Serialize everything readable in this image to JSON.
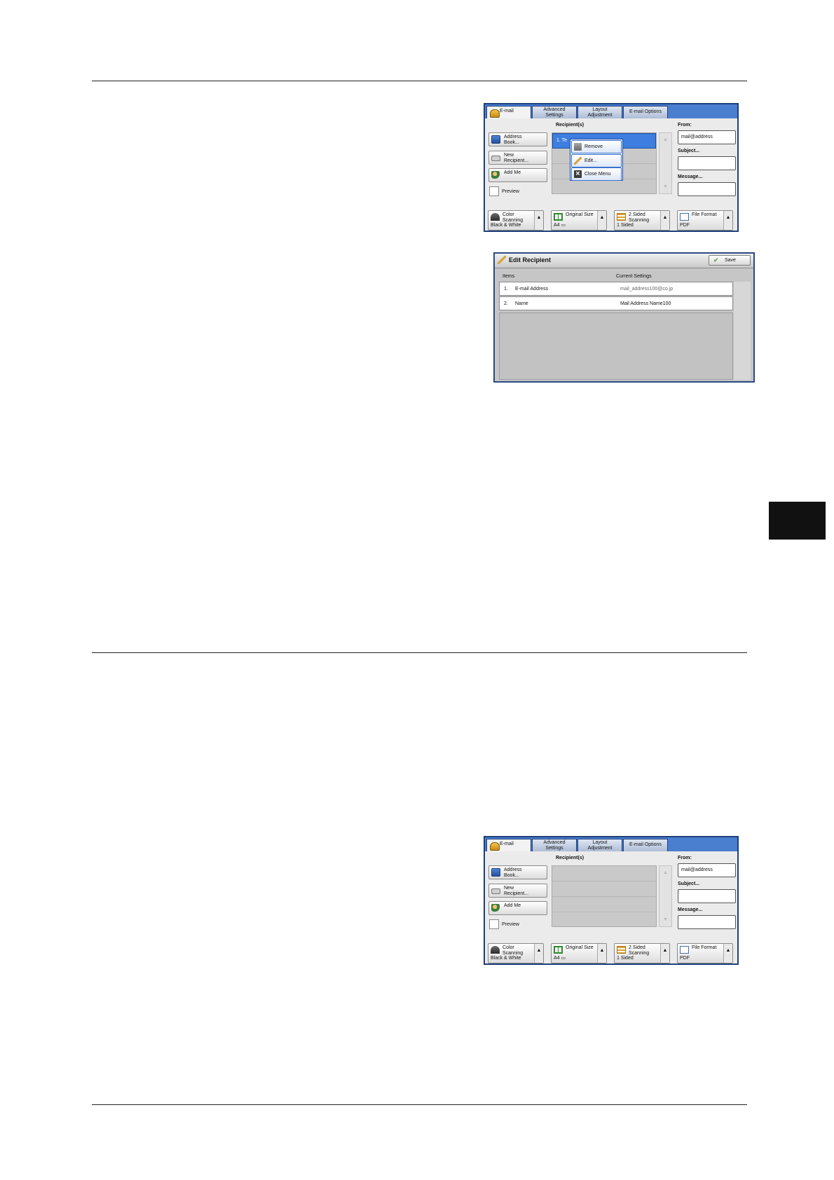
{
  "email_screen_top": {
    "tabs": [
      {
        "label": "E-mail"
      },
      {
        "label": "Advanced\nSettings"
      },
      {
        "label": "Layout\nAdjustment"
      },
      {
        "label": "E-mail Options"
      }
    ],
    "recipients_label": "Recipient(s)",
    "recipient_row_1": "1.    Te",
    "address_book": "Address\nBook...",
    "new_recipient": "New\nRecipient...",
    "add_me": "Add Me",
    "preview": "Preview",
    "from_label": "From:",
    "from_value": "mail@address",
    "subject_label": "Subject...",
    "message_label": "Message...",
    "popup": {
      "remove": "Remove",
      "edit": "Edit...",
      "close_menu": "Close Menu"
    },
    "bottom": {
      "color_title": "Color\nScanning",
      "color_value": "Black & White",
      "size_title": "Original Size",
      "size_value": "A4 ▭",
      "sided_title": "2 Sided\nScanning",
      "sided_value": "1 Sided",
      "format_title": "File Format",
      "format_value": "PDF"
    },
    "icons": {
      "tab": "email-icon",
      "book": "address-book-icon",
      "kbd": "keyboard-icon",
      "me": "user-icon"
    }
  },
  "edit_recipient": {
    "title": "Edit Recipient",
    "save": "Save",
    "col_items": "Items",
    "col_current": "Current Settings",
    "rows": [
      {
        "num": "1.",
        "item": "E-mail Address",
        "value": "mail_address100@co.jp"
      },
      {
        "num": "2.",
        "item": "Name",
        "value": "Mail Address Name100"
      }
    ]
  },
  "email_screen_bottom": {
    "recipients_label": "Recipient(s)"
  },
  "colors": {
    "tabbar": "#4a7fd0",
    "selected_row": "#3d7ee0",
    "side_tab": "#111111"
  }
}
